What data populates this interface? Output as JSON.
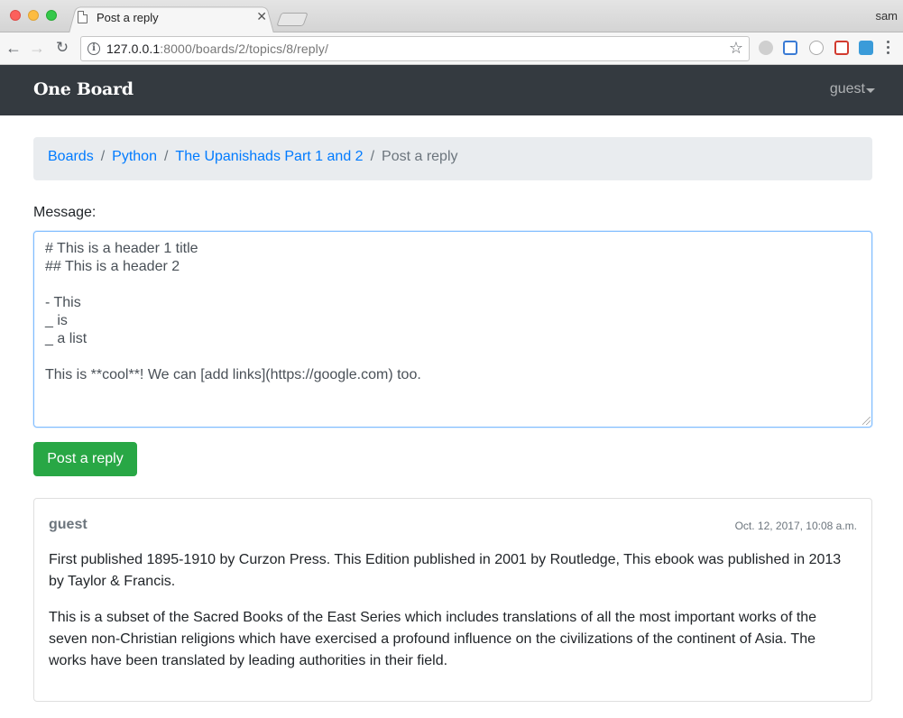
{
  "browser": {
    "tab_title": "Post a reply",
    "profile_name": "sam",
    "url_host": "127.0.0.1",
    "url_rest": ":8000/boards/2/topics/8/reply/"
  },
  "navbar": {
    "brand": "One Board",
    "user": "guest"
  },
  "breadcrumb": {
    "items": [
      "Boards",
      "Python",
      "The Upanishads Part 1 and 2"
    ],
    "active": "Post a reply",
    "separator": "/"
  },
  "form": {
    "message_label": "Message:",
    "message_value": "# This is a header 1 title\n## This is a header 2\n\n- This\n_ is\n_ a list\n\nThis is **cool**! We can [add links](https://google.com) too.",
    "submit_label": "Post a reply"
  },
  "post": {
    "author": "guest",
    "date": "Oct. 12, 2017, 10:08 a.m.",
    "paragraphs": [
      "First published 1895-1910 by Curzon Press. This Edition published in 2001 by Routledge, This ebook was published in 2013 by Taylor & Francis.",
      "This is a subset of the Sacred Books of the East Series which includes translations of all the most important works of the seven non-Christian religions which have exercised a profound influence on the civilizations of the continent of Asia. The works have been translated by leading authorities in their field."
    ]
  },
  "colors": {
    "navbar_bg": "#343a40",
    "link": "#007bff",
    "success": "#28a745",
    "muted": "#6c757d"
  }
}
